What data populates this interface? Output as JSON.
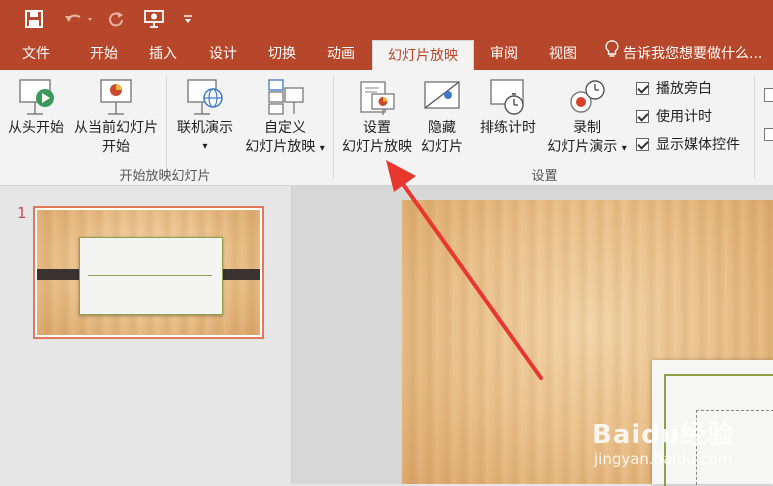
{
  "tabs": [
    "文件",
    "开始",
    "插入",
    "设计",
    "切换",
    "动画",
    "幻灯片放映",
    "审阅",
    "视图"
  ],
  "tell_me": "告诉我您想要做什么...",
  "ribbon": {
    "from_beginning": "从头开始",
    "from_current_1": "从当前幻灯片",
    "from_current_2": "开始",
    "online_present": "联机演示",
    "custom_1": "自定义",
    "custom_2": "幻灯片放映",
    "group1_label": "开始放映幻灯片",
    "setup_1": "设置",
    "setup_2": "幻灯片放映",
    "hide_1": "隐藏",
    "hide_2": "幻灯片",
    "rehearse": "排练计时",
    "record_1": "录制",
    "record_2": "幻灯片演示",
    "group2_label": "设置",
    "checkboxes": [
      "播放旁白",
      "使用计时",
      "显示媒体控件"
    ]
  },
  "slide_number": "1",
  "watermark": {
    "brand": "Baidu经验",
    "url": "jingyan.baidu.com"
  },
  "colors": {
    "accent": "#b7472a",
    "arrow": "#e8372e"
  }
}
